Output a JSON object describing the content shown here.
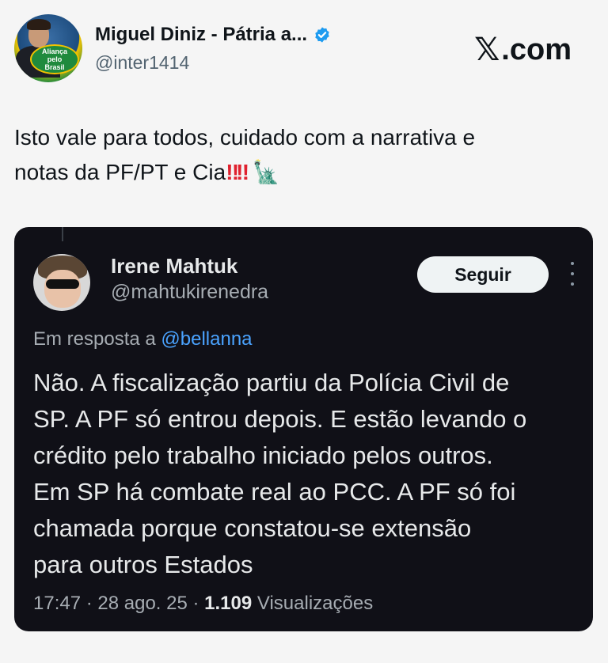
{
  "author": {
    "name": "Miguel Diniz - Pátria a...",
    "handle": "@inter1414",
    "avatar_text": [
      "Aliança",
      "pelo",
      "Brasil"
    ],
    "verified_icon": "verified-badge-icon",
    "verified_color": "#1d9bf0"
  },
  "brand": {
    "x_glyph": "𝕏",
    "label": ".com"
  },
  "post": {
    "text_line1": "Isto vale para todos, cuidado com a narrativa e",
    "text_line2": "notas da PF/PT e Cia",
    "emoji_bang": "‼",
    "emoji_liberty": "🗽"
  },
  "embedded_tweet": {
    "name": "Irene Mahtuk",
    "handle": "@mahtukirenedra",
    "follow_label": "Seguir",
    "reply_prefix": "Em resposta a",
    "reply_mention": "@bellanna",
    "text_lines": [
      "Não. A fiscalização partiu da Polícia Civil de",
      "SP. A PF só entrou depois. E estão levando o",
      "crédito pelo trabalho iniciado pelos outros.",
      "Em SP há combate real ao PCC. A PF só foi",
      "chamada porque constatou-se extensão",
      "para outros Estados"
    ],
    "time": "17:47",
    "date": "28 ago. 25",
    "views_count": "1.109",
    "views_label": "Visualizações",
    "separator": " · "
  }
}
